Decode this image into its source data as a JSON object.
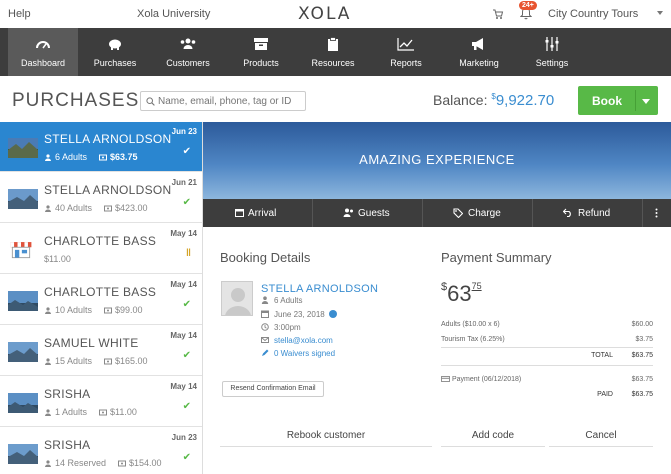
{
  "topbar": {
    "help": "Help",
    "university": "Xola University",
    "logo": "XOLA",
    "notifications": "24+",
    "account": "City Country Tours"
  },
  "nav": [
    {
      "label": "Dashboard",
      "icon": "dashboard-icon"
    },
    {
      "label": "Purchases",
      "icon": "piggy-bank-icon"
    },
    {
      "label": "Customers",
      "icon": "customers-icon"
    },
    {
      "label": "Products",
      "icon": "box-icon"
    },
    {
      "label": "Resources",
      "icon": "clipboard-icon"
    },
    {
      "label": "Reports",
      "icon": "line-chart-icon"
    },
    {
      "label": "Marketing",
      "icon": "megaphone-icon"
    },
    {
      "label": "Settings",
      "icon": "sliders-icon"
    }
  ],
  "header": {
    "title": "PURCHASES",
    "search_placeholder": "Name, email, phone, tag or ID",
    "balance_label": "Balance:",
    "balance_currency": "$",
    "balance_amount": "9,922.70",
    "book_label": "Book"
  },
  "purchases": [
    {
      "name": "STELLA ARNOLDSON",
      "date": "Jun 23",
      "guests": "6 Adults",
      "amount": "$63.75",
      "status": "paid"
    },
    {
      "name": "STELLA ARNOLDSON",
      "date": "Jun 21",
      "guests": "40 Adults",
      "amount": "$423.00",
      "status": "paid"
    },
    {
      "name": "CHARLOTTE BASS",
      "date": "May 14",
      "guests": "",
      "amount": "$11.00",
      "status": "pending"
    },
    {
      "name": "CHARLOTTE BASS",
      "date": "May 14",
      "guests": "10 Adults",
      "amount": "$99.00",
      "status": "paid"
    },
    {
      "name": "SAMUEL WHITE",
      "date": "May 14",
      "guests": "15 Adults",
      "amount": "$165.00",
      "status": "paid"
    },
    {
      "name": "SRISHA",
      "date": "May 14",
      "guests": "1 Adults",
      "amount": "$11.00",
      "status": "paid"
    },
    {
      "name": "SRISHA",
      "date": "Jun 23",
      "guests": "14 Reserved",
      "amount": "$154.00",
      "status": "paid"
    }
  ],
  "experience": {
    "title": "AMAZING EXPERIENCE",
    "actions": {
      "arrival": "Arrival",
      "guests": "Guests",
      "charge": "Charge",
      "refund": "Refund"
    }
  },
  "booking": {
    "section_title": "Booking Details",
    "customer_name": "STELLA ARNOLDSON",
    "guests": "6 Adults",
    "date": "June 23, 2018",
    "time": "3:00pm",
    "email": "stella@xola.com",
    "waivers": "0 Waivers signed",
    "resend_label": "Resend Confirmation Email",
    "rebook_label": "Rebook customer"
  },
  "payment": {
    "section_title": "Payment Summary",
    "total_currency": "$",
    "total_dollars": "63",
    "total_cents": "75",
    "lines": [
      {
        "label": "Adults ($10.00 x 6)",
        "value": "$60.00"
      },
      {
        "label": "Tourism Tax (6.25%)",
        "value": "$3.75"
      }
    ],
    "total_label": "TOTAL",
    "total_value": "$63.75",
    "payment_label": "Payment (06/12/2018)",
    "payment_value": "$63.75",
    "paid_label": "PAID",
    "paid_value": "$63.75",
    "add_code_label": "Add code",
    "cancel_label": "Cancel"
  },
  "colors": {
    "accent": "#2a86d0",
    "link": "#3a8dd0",
    "success": "#58b947",
    "nav_bg": "#3d3d3d",
    "badge": "#e8542f"
  }
}
